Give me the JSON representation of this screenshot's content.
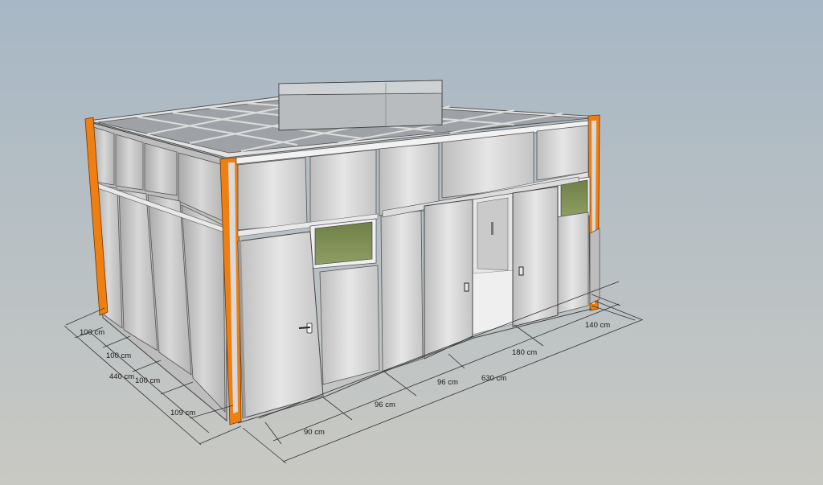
{
  "colors": {
    "sky_top": "#a9b9c6",
    "ground": "#c9c9c3",
    "frame_orange": "#f07f12",
    "panel": "#cfcfcf",
    "window_glass": "#7d8f55",
    "roof": "#9a9ea2",
    "dimension_line": "#333333"
  },
  "model": {
    "subject": "modular-cleanroom-enclosure",
    "icons": [
      "door-handle-icon",
      "sliding-door-handle-icon",
      "fan-filter-unit"
    ]
  },
  "dimensions": {
    "left_side": [
      "100 cm",
      "100 cm",
      "100 cm",
      "109 cm"
    ],
    "left_total": "440 cm",
    "front": [
      "90 cm",
      "96 cm",
      "96 cm",
      "180 cm",
      "140 cm"
    ],
    "front_total": "630 cm"
  }
}
